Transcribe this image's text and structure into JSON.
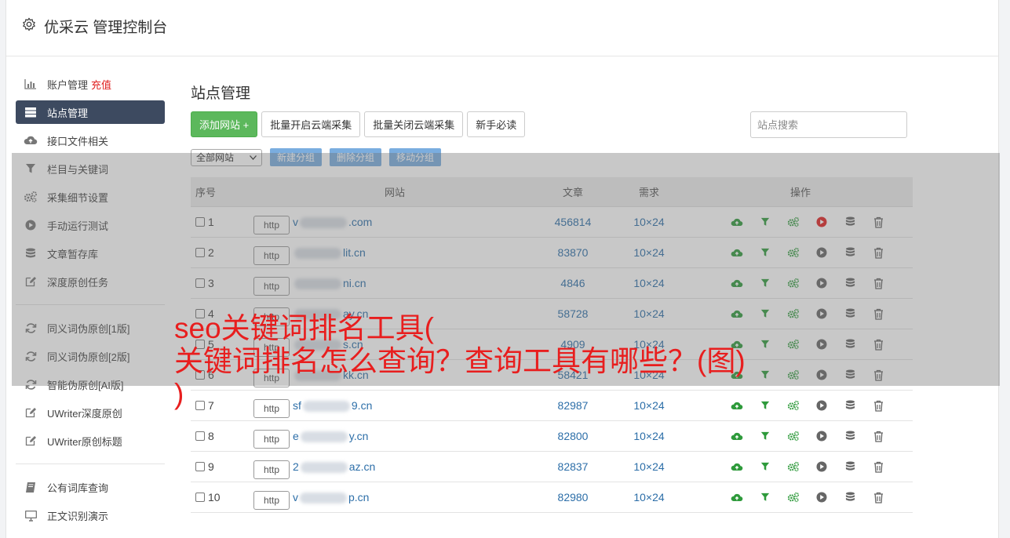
{
  "header": {
    "title": "优采云 管理控制台"
  },
  "sidebar": {
    "group1": [
      {
        "label": "账户管理",
        "badge": "充值",
        "icon": "bar-chart-icon",
        "active": false
      },
      {
        "label": "站点管理",
        "icon": "server-icon",
        "active": true
      },
      {
        "label": "接口文件相关",
        "icon": "cloud-upload-icon",
        "active": false
      },
      {
        "label": "栏目与关键词",
        "icon": "filter-icon",
        "active": false
      },
      {
        "label": "采集细节设置",
        "icon": "cogs-icon",
        "active": false
      },
      {
        "label": "手动运行测试",
        "icon": "play-icon",
        "active": false
      },
      {
        "label": "文章暂存库",
        "icon": "database-icon",
        "active": false
      },
      {
        "label": "深度原创任务",
        "icon": "edit-icon",
        "active": false
      }
    ],
    "group2": [
      {
        "label": "同义词伪原创[1版]",
        "icon": "refresh-icon"
      },
      {
        "label": "同义词伪原创[2版]",
        "icon": "refresh-icon"
      },
      {
        "label": "智能伪原创[AI版]",
        "icon": "refresh-icon"
      },
      {
        "label": "UWriter深度原创",
        "icon": "edit-icon"
      },
      {
        "label": "UWriter原创标题",
        "icon": "edit-icon"
      }
    ],
    "group3": [
      {
        "label": "公有词库查询",
        "icon": "book-icon"
      },
      {
        "label": "正文识别演示",
        "icon": "monitor-icon"
      }
    ]
  },
  "main": {
    "title": "站点管理",
    "buttons": {
      "add": "添加网站 +",
      "enable_all": "批量开启云端采集",
      "disable_all": "批量关闭云端采集",
      "guide": "新手必读"
    },
    "search_placeholder": "站点搜索",
    "group_select": "全部网站",
    "group_buttons": {
      "new": "新建分组",
      "delete": "删除分组",
      "move": "移动分组"
    },
    "columns": {
      "no": "序号",
      "site": "网站",
      "articles": "文章",
      "need": "需求",
      "ops": "操作"
    },
    "rows": [
      {
        "no": "1",
        "protocol": "http",
        "prefix": "v",
        "suffix": ".com",
        "articles": "456814",
        "need": "10×24",
        "running": true
      },
      {
        "no": "2",
        "protocol": "http",
        "prefix": "",
        "suffix": "lit.cn",
        "articles": "83870",
        "need": "10×24",
        "running": false
      },
      {
        "no": "3",
        "protocol": "http",
        "prefix": "",
        "suffix": "ni.cn",
        "articles": "4846",
        "need": "10×24",
        "running": false
      },
      {
        "no": "4",
        "protocol": "http",
        "prefix": "",
        "suffix": "ay.cn",
        "articles": "58728",
        "need": "10×24",
        "running": false
      },
      {
        "no": "5",
        "protocol": "http",
        "prefix": "",
        "suffix": "s.cn",
        "articles": "4909",
        "need": "10×24",
        "running": false
      },
      {
        "no": "6",
        "protocol": "http",
        "prefix": "",
        "suffix": "kk.cn",
        "articles": "58421",
        "need": "10×24",
        "running": false
      },
      {
        "no": "7",
        "protocol": "http",
        "prefix": "sf",
        "suffix": "9.cn",
        "articles": "82987",
        "need": "10×24",
        "running": false
      },
      {
        "no": "8",
        "protocol": "http",
        "prefix": "e",
        "suffix": "y.cn",
        "articles": "82800",
        "need": "10×24",
        "running": false
      },
      {
        "no": "9",
        "protocol": "http",
        "prefix": "2",
        "suffix": "az.cn",
        "articles": "82837",
        "need": "10×24",
        "running": false
      },
      {
        "no": "10",
        "protocol": "http",
        "prefix": "v",
        "suffix": "p.cn",
        "articles": "82980",
        "need": "10×24",
        "running": false
      }
    ]
  },
  "overlay_title": {
    "line1": "seo关键词排名工具(",
    "line2": "关键词排名怎么查询？查询工具有哪些？(图)",
    "line3": ")"
  },
  "colors": {
    "accent_green": "#5cb85c",
    "sidebar_active": "#3d4a60",
    "link_blue": "#2c6ea8",
    "title_red": "#e81e1e",
    "play_red": "#e02020"
  }
}
